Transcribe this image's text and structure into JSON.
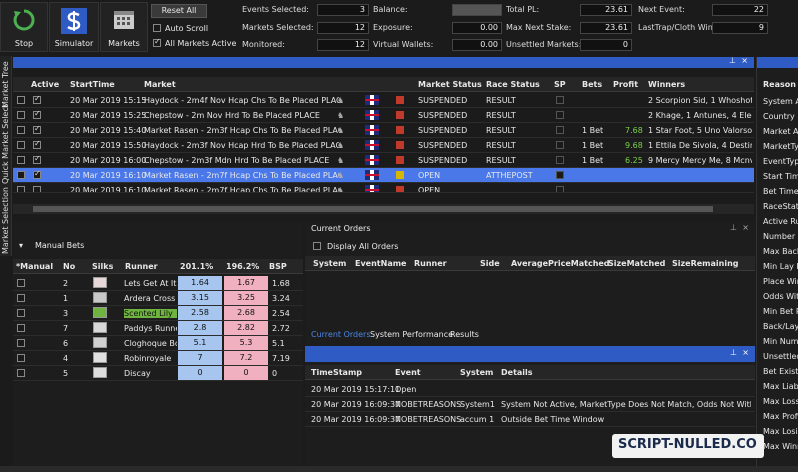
{
  "toolbar": {
    "stop_label": "Stop",
    "simulator_label": "Simulator",
    "markets_label": "Markets",
    "reset_all_label": "Reset All",
    "auto_scroll_label": "Auto Scroll",
    "all_markets_active_label": "All Markets Active",
    "auto_scroll_checked": false,
    "all_markets_active_checked": true
  },
  "stats": {
    "events_selected_label": "Events Selected:",
    "events_selected": "3",
    "markets_selected_label": "Markets Selected:",
    "markets_selected": "12",
    "monitored_label": "Monitored:",
    "monitored": "12",
    "balance_label": "Balance:",
    "balance": "",
    "exposure_label": "Exposure:",
    "exposure": "0.00",
    "virtual_wallets_label": "Virtual Wallets:",
    "virtual_wallets": "0.00",
    "total_pl_label": "Total PL:",
    "total_pl": "23.61",
    "max_next_stake_label": "Max Next Stake:",
    "max_next_stake": "23.61",
    "unsettled_markets_label": "Unsettled Markets:",
    "unsettled_markets": "0",
    "next_event_label": "Next Event:",
    "next_event": "22",
    "lasttrap_label": "LastTrap/Cloth Win:",
    "lasttrap": "9"
  },
  "side_tabs": [
    "Market Tree",
    "Quick Market Select",
    "Market Selection"
  ],
  "markets": {
    "columns": [
      "Active",
      "StartTime",
      "Market",
      "Market Status",
      "Race Status",
      "SP",
      "Bets",
      "Profit",
      "Winners"
    ],
    "rows": [
      {
        "active": true,
        "start": "20 Mar 2019 15:15",
        "market": "Haydock - 2m4f Nov Hcap Chs To Be Placed PLACE",
        "status": "SUSPENDED",
        "race": "RESULT",
        "bets": "",
        "profit": "",
        "winners": "2 Scorpion Sid, 1 Whoshot",
        "flag": "red"
      },
      {
        "active": true,
        "start": "20 Mar 2019 15:25",
        "market": "Chepstow - 2m Nov Hrd To Be Placed PLACE",
        "status": "SUSPENDED",
        "race": "RESULT",
        "bets": "",
        "profit": "",
        "winners": "2 Khage, 1 Antunes, 4 Elec",
        "flag": "red"
      },
      {
        "active": true,
        "start": "20 Mar 2019 15:40",
        "market": "Market Rasen - 2m3f Hcap Chs To Be Placed PLACE",
        "status": "SUSPENDED",
        "race": "RESULT",
        "bets": "1 Bet",
        "profit": "7.68",
        "winners": "1 Star Foot, 5 Uno Valorso",
        "flag": "red"
      },
      {
        "active": true,
        "start": "20 Mar 2019 15:50",
        "market": "Haydock - 2m3f Nov Hcap Hrd To Be Placed PLACE",
        "status": "SUSPENDED",
        "race": "RESULT",
        "bets": "1 Bet",
        "profit": "9.68",
        "winners": "1 Ettila De Sivola, 4 Destin",
        "flag": "red"
      },
      {
        "active": true,
        "start": "20 Mar 2019 16:00",
        "market": "Chepstow - 2m3f Mdn Hrd To Be Placed PLACE",
        "status": "SUSPENDED",
        "race": "RESULT",
        "bets": "1 Bet",
        "profit": "6.25",
        "winners": "9 Mercy Mercy Me, 8 Mcnv",
        "flag": "red"
      },
      {
        "active": true,
        "start": "20 Mar 2019 16:10",
        "market": "Market Rasen - 2m7f Hcap Chs To Be Placed PLACE",
        "status": "OPEN",
        "race": "ATTHEPOST",
        "bets": "",
        "profit": "",
        "winners": "",
        "flag": "yellow"
      },
      {
        "active": false,
        "start": "20 Mar 2019 16:10",
        "market": "Market Rasen - 2m7f Hcap Chs To Be Placed PLACE",
        "status": "OPEN",
        "race": "",
        "bets": "",
        "profit": "",
        "winners": "",
        "flag": "red"
      }
    ]
  },
  "manual_bets": {
    "title": "Manual Bets",
    "columns": [
      "*Manual",
      "No",
      "Silks",
      "Runner",
      "201.1%",
      "196.2%",
      "BSP"
    ],
    "rows": [
      {
        "no": "2",
        "runner": "Lets Get At It",
        "back": "1.64",
        "lay": "1.67",
        "bsp": "1.68"
      },
      {
        "no": "1",
        "runner": "Ardera Cross",
        "back": "3.15",
        "lay": "3.25",
        "bsp": "3.24"
      },
      {
        "no": "3",
        "runner": "Scented Lily",
        "back": "2.58",
        "lay": "2.68",
        "bsp": "2.54"
      },
      {
        "no": "7",
        "runner": "Paddys Runne",
        "back": "2.8",
        "lay": "2.82",
        "bsp": "2.72"
      },
      {
        "no": "6",
        "runner": "Cloghoque Bc",
        "back": "5.1",
        "lay": "5.3",
        "bsp": "5.1"
      },
      {
        "no": "4",
        "runner": "Robinroyale",
        "back": "7",
        "lay": "7.2",
        "bsp": "7.19"
      },
      {
        "no": "5",
        "runner": "Discay",
        "back": "0",
        "lay": "0",
        "bsp": "0"
      }
    ]
  },
  "current_orders": {
    "title": "Current Orders",
    "display_all_label": "Display All Orders",
    "columns": [
      "System",
      "EventName",
      "Runner",
      "Side",
      "AveragePriceMatched",
      "SizeMatched",
      "SizeRemaining"
    ]
  },
  "bottom_tabs": [
    "Current Orders",
    "System Performance",
    "Results"
  ],
  "log": {
    "columns": [
      "TimeStamp",
      "Event",
      "System",
      "Details"
    ],
    "rows": [
      {
        "time": "20 Mar 2019 15:17:11",
        "event": "Open",
        "system": "",
        "details": ""
      },
      {
        "time": "20 Mar 2019 16:09:37",
        "event": "NOBETREASONS",
        "system": "System1",
        "details": "System Not Active, MarketType Does Not Match, Odds Not Within"
      },
      {
        "time": "20 Mar 2019 16:09:37",
        "event": "NOBETREASONS",
        "system": "accum 1",
        "details": "Outside Bet Time Window"
      }
    ]
  },
  "reason_panel": {
    "title": "Reason",
    "items": [
      "System Ac",
      "Country M",
      "Market Ac",
      "MarketTyp",
      "EventType",
      "Start Tim",
      "Bet Time W",
      "RaceStatu",
      "Active Run",
      "Number Of",
      "Max Back",
      "Min Lay B",
      "Place Win",
      "Odds With",
      "Min Bet Re",
      "Back/Lay I",
      "Min Numb",
      "Unsettled",
      "Bet Exists",
      "Max Liabi",
      "Max Loss",
      "Max Profi",
      "Max Losin",
      "Max Winni"
    ]
  },
  "watermark": "SCRIPT-NULLED.CO"
}
